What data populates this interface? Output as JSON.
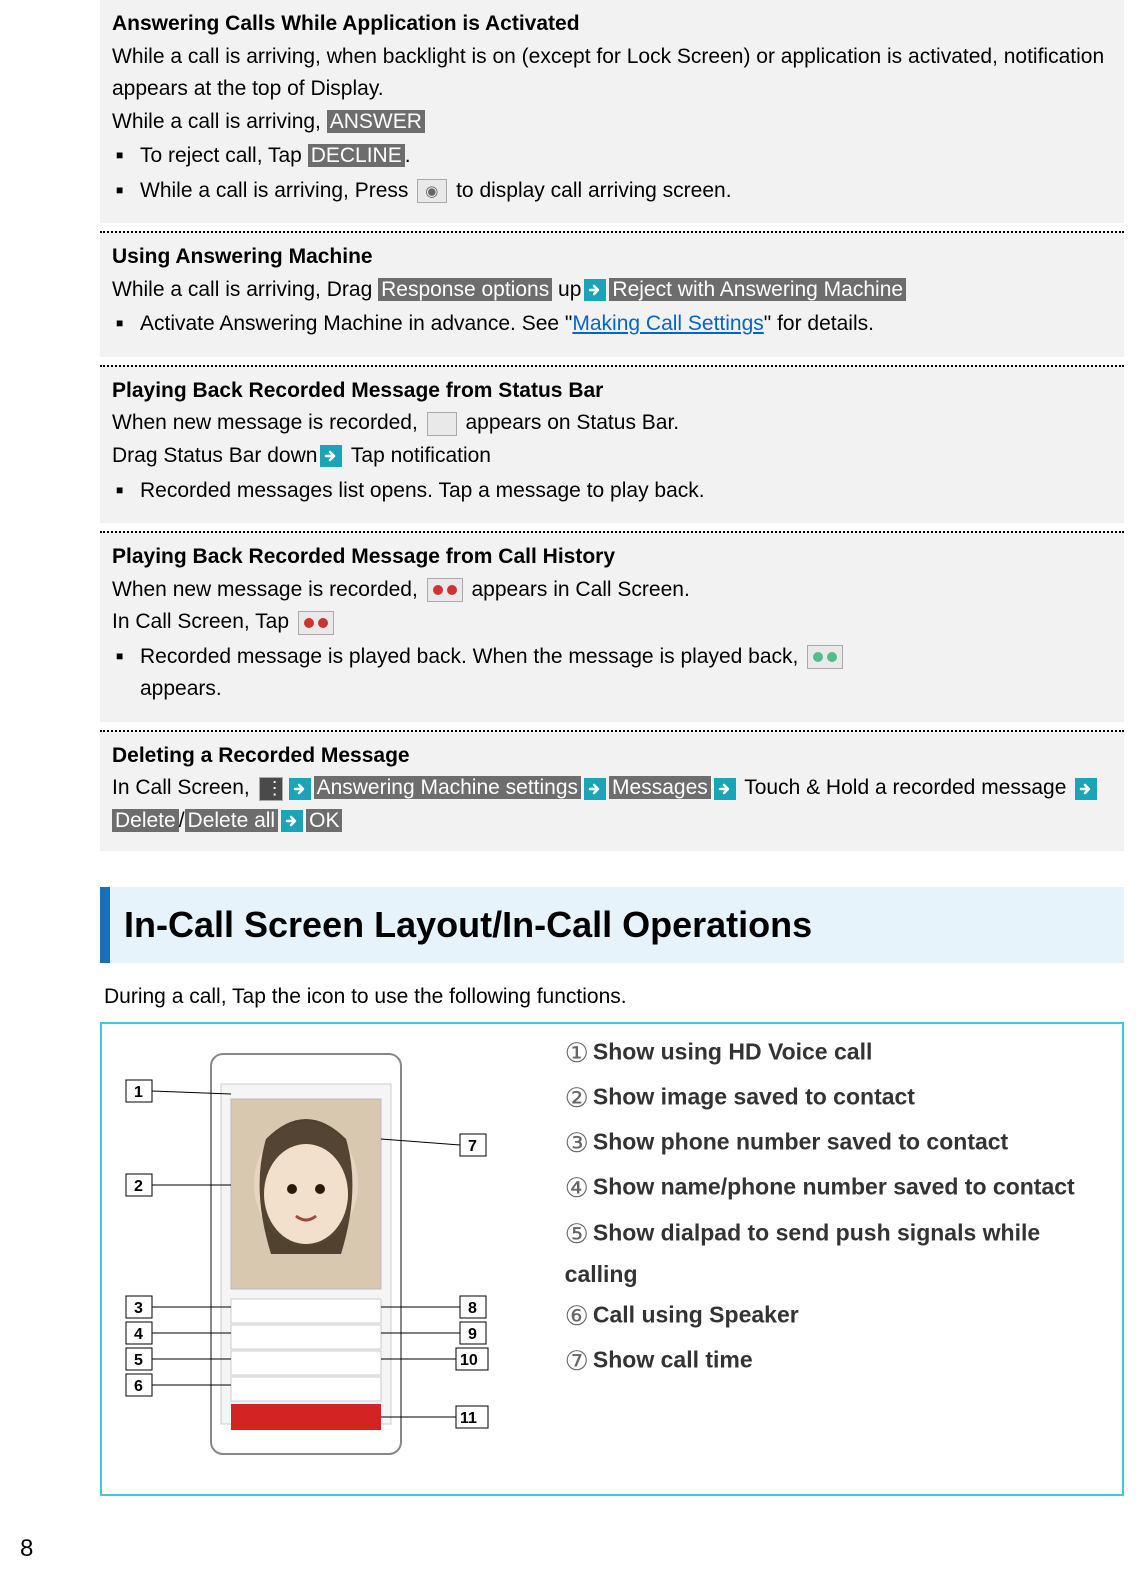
{
  "sections": {
    "answering_calls": {
      "title": "Answering Calls While Application is Activated",
      "para1": "While a call is arriving, when backlight is on (except for Lock Screen) or application is activated, notification appears at the top of Display.",
      "para2_prefix": "While a call is arriving, ",
      "answer_token": "ANSWER",
      "bullet1_prefix": "To reject call, Tap ",
      "decline_token": "DECLINE",
      "bullet1_suffix": ".",
      "bullet2_prefix": "While a call is arriving, Press ",
      "bullet2_suffix": " to display call arriving screen."
    },
    "using_machine": {
      "title": "Using Answering Machine",
      "para_prefix": "While a call is arriving, Drag ",
      "token_response": "Response options",
      "para_mid": " up",
      "token_reject": "Reject with Answering Machine",
      "bullet_prefix": "Activate Answering Machine in advance. See \"",
      "link_text": "Making Call Settings",
      "bullet_suffix": "\" for details."
    },
    "play_statusbar": {
      "title": "Playing Back Recorded Message from Status Bar",
      "line1_prefix": "When new message is recorded, ",
      "line1_suffix": " appears on Status Bar.",
      "line2_prefix": "Drag Status Bar down",
      "line2_suffix": " Tap notification",
      "bullet": "Recorded messages list opens. Tap a message to play back."
    },
    "play_history": {
      "title": "Playing Back Recorded Message from Call History",
      "line1_prefix": "When new message is recorded, ",
      "line1_suffix": " appears in Call Screen.",
      "line2": "In Call Screen, Tap ",
      "bullet_prefix": "Recorded message is played back. When the message is played back, ",
      "bullet_suffix": "appears."
    },
    "deleting": {
      "title": "Deleting a Recorded Message",
      "line_prefix": "In Call Screen, ",
      "token_settings": "Answering Machine settings",
      "token_messages": "Messages",
      "line_mid": " Touch & Hold a recorded message ",
      "token_delete": "Delete",
      "slash": "/",
      "token_delete_all": "Delete all",
      "token_ok": "OK"
    }
  },
  "heading": "In-Call Screen Layout/In-Call Operations",
  "intro": "During a call, Tap the icon to use the following functions.",
  "legend": {
    "1": "Show using HD Voice call",
    "2": "Show image saved to contact",
    "3": "Show phone number saved to contact",
    "4": "Show name/phone number saved to contact",
    "5": "Show dialpad to send push signals while calling",
    "6": "Call using Speaker",
    "7": "Show call time"
  },
  "circled_numbers": {
    "1": "①",
    "2": "②",
    "3": "③",
    "4": "④",
    "5": "⑤",
    "6": "⑥",
    "7": "⑦"
  },
  "phone_labels": {
    "l1": "1",
    "l2": "2",
    "l3": "3",
    "l4": "4",
    "l5": "5",
    "l6": "6",
    "r7": "7",
    "r8": "8",
    "r9": "9",
    "r10": "10",
    "r11": "11"
  },
  "page_number": "8"
}
